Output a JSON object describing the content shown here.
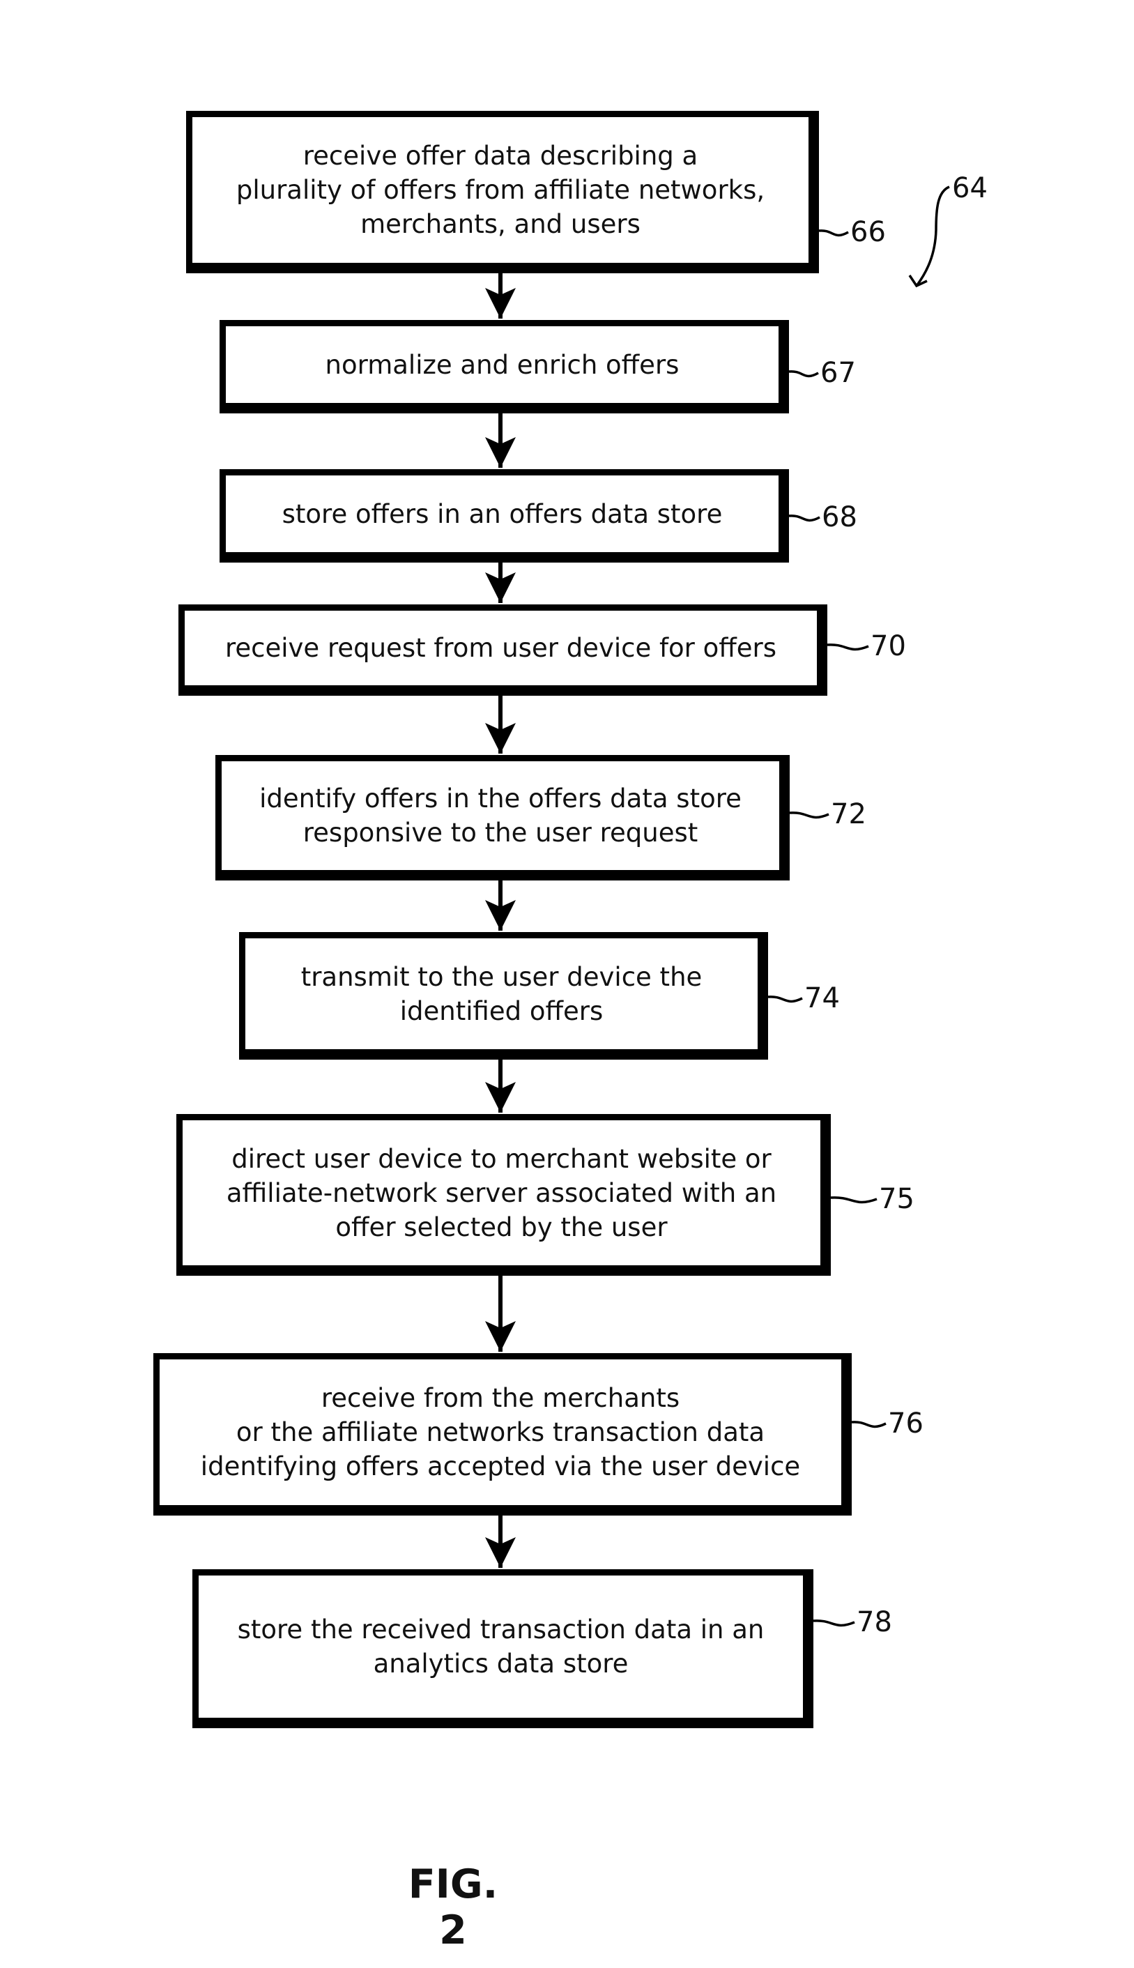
{
  "figure": {
    "title": "FIG. 2",
    "process_ref": "64"
  },
  "steps": [
    {
      "ref": "66",
      "text": "receive offer data describing a\nplurality of offers from affiliate networks,\nmerchants, and users"
    },
    {
      "ref": "67",
      "text": "normalize and enrich offers"
    },
    {
      "ref": "68",
      "text": "store offers in an offers data store"
    },
    {
      "ref": "70",
      "text": "receive request from user device for offers"
    },
    {
      "ref": "72",
      "text": "identify offers in the offers data store\nresponsive to the user request"
    },
    {
      "ref": "74",
      "text": "transmit to the user device the\nidentified offers"
    },
    {
      "ref": "75",
      "text": "direct user device to merchant website or\naffiliate-network server associated with an\noffer selected by the user"
    },
    {
      "ref": "76",
      "text": "receive from the merchants\nor the affiliate networks transaction data\nidentifying offers accepted via the user device"
    },
    {
      "ref": "78",
      "text": "store the received transaction data in an\nanalytics data store"
    }
  ],
  "flow": [
    {
      "from": "66",
      "to": "67"
    },
    {
      "from": "67",
      "to": "68"
    },
    {
      "from": "68",
      "to": "70"
    },
    {
      "from": "70",
      "to": "72"
    },
    {
      "from": "72",
      "to": "74"
    },
    {
      "from": "74",
      "to": "75"
    },
    {
      "from": "75",
      "to": "76"
    },
    {
      "from": "76",
      "to": "78"
    }
  ]
}
